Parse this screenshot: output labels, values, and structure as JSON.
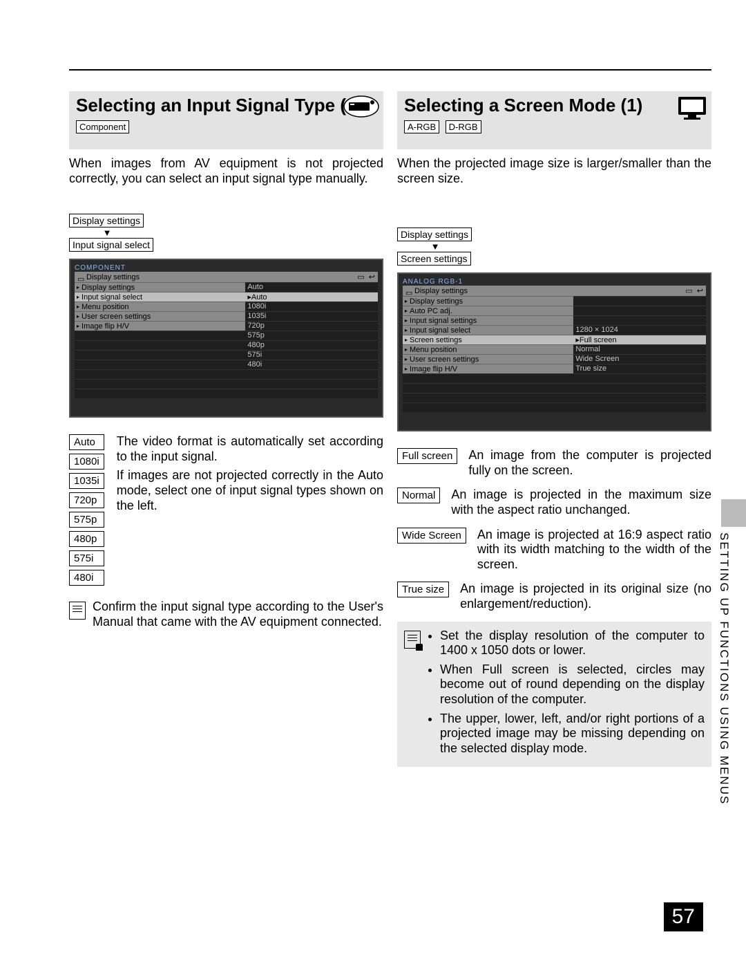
{
  "page_number": "57",
  "side_label": "SETTING UP FUNCTIONS USING MENUS",
  "left": {
    "title": "Selecting an Input Signal Type (3)",
    "tags": [
      "Component"
    ],
    "intro": "When images from AV equipment is not projected correctly, you can select an input signal type manually.",
    "crumb": [
      "Display settings",
      "Input signal select"
    ],
    "screenshot": {
      "heading": "COMPONENT",
      "bar": "Display settings",
      "items": [
        "Display settings",
        "Input signal select",
        "Menu position",
        "User screen settings",
        "Image flip H/V"
      ],
      "values": [
        "Auto",
        "▸Auto",
        "1080i",
        "1035i",
        "720p",
        "575p",
        "480p",
        "575i",
        "480i"
      ]
    },
    "options": [
      "Auto",
      "1080i",
      "1035i",
      "720p",
      "575p",
      "480p",
      "575i",
      "480i"
    ],
    "options_desc": "The video format is automatically set according to the input signal.\nIf images are not projected correctly in the Auto mode, select one of input signal types shown on the left.",
    "note": "Confirm the input signal type according to the User's Manual that came with the AV equipment connected."
  },
  "right": {
    "title": "Selecting a Screen Mode (1)",
    "tags": [
      "A-RGB",
      "D-RGB"
    ],
    "intro": "When the projected image size is larger/smaller than the screen size.",
    "crumb": [
      "Display settings",
      "Screen settings"
    ],
    "screenshot": {
      "heading": "ANALOG RGB-1",
      "bar": "Display settings",
      "items": [
        "Display settings",
        "Auto PC adj.",
        "Input signal settings",
        "Input signal select",
        "Screen settings",
        "Menu position",
        "User screen settings",
        "Image flip H/V"
      ],
      "values": [
        "",
        "",
        "",
        "1280 × 1024",
        "▸Full screen",
        "Normal",
        "Wide Screen",
        "True size"
      ]
    },
    "pairs": [
      {
        "label": "Full screen",
        "desc": "An image from the computer is projected fully on the screen."
      },
      {
        "label": "Normal",
        "desc": "An image is projected in the maximum size with the aspect ratio unchanged."
      },
      {
        "label": "Wide Screen",
        "desc": "An image is projected at 16:9 aspect ratio with its width matching to the width of the screen."
      },
      {
        "label": "True size",
        "desc": "An image is projected in its original size (no enlargement/reduction)."
      }
    ],
    "note_items": [
      "Set the display resolution of the computer to 1400 x 1050 dots or lower.",
      "When Full screen is selected, circles may become out of round depending on the display resolution of the computer.",
      "The upper, lower, left, and/or right portions of a projected image may be missing depending on the selected display mode."
    ]
  }
}
